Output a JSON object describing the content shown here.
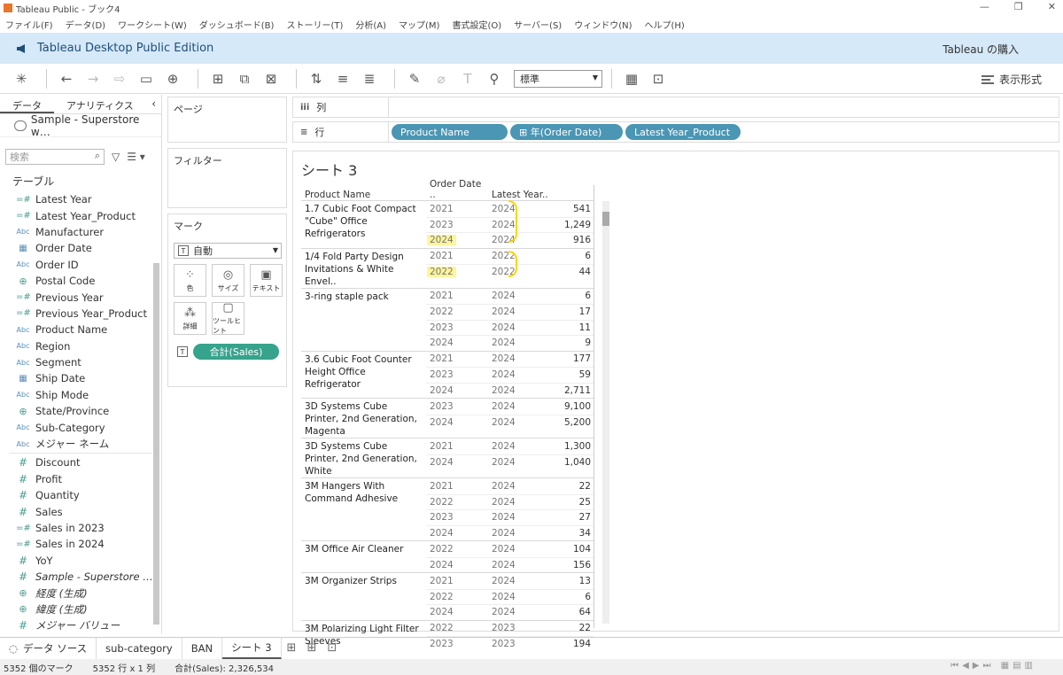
{
  "window": {
    "title": "Tableau Public - ブック4",
    "controls": [
      "—",
      "❐",
      "✕"
    ]
  },
  "menu": [
    "ファイル(F)",
    "データ(D)",
    "ワークシート(W)",
    "ダッシュボード(B)",
    "ストーリー(T)",
    "分析(A)",
    "マップ(M)",
    "書式設定(O)",
    "サーバー(S)",
    "ウィンドウ(N)",
    "ヘルプ(H)"
  ],
  "promo": {
    "label": "Tableau Desktop Public Edition",
    "buy": "Tableau の購入"
  },
  "toolbar": {
    "view_select": "標準",
    "show_me": "表示形式"
  },
  "datapane": {
    "tab_data": "データ",
    "tab_analytics": "アナリティクス",
    "datasource": "Sample - Superstore w…",
    "search_placeholder": "検索",
    "tables_header": "テーブル",
    "dimensions": [
      {
        "icon": "=#",
        "label": "Latest Year"
      },
      {
        "icon": "=#",
        "label": "Latest Year_Product"
      },
      {
        "icon": "Abc",
        "label": "Manufacturer"
      },
      {
        "icon": "date",
        "label": "Order Date"
      },
      {
        "icon": "Abc",
        "label": "Order ID"
      },
      {
        "icon": "geo",
        "label": "Postal Code"
      },
      {
        "icon": "=#",
        "label": "Previous Year"
      },
      {
        "icon": "=#",
        "label": "Previous Year_Product"
      },
      {
        "icon": "Abc",
        "label": "Product Name"
      },
      {
        "icon": "Abc",
        "label": "Region"
      },
      {
        "icon": "Abc",
        "label": "Segment"
      },
      {
        "icon": "date",
        "label": "Ship Date"
      },
      {
        "icon": "Abc",
        "label": "Ship Mode"
      },
      {
        "icon": "geo",
        "label": "State/Province"
      },
      {
        "icon": "Abc",
        "label": "Sub-Category"
      },
      {
        "icon": "Abc",
        "label": "メジャー ネーム"
      }
    ],
    "measures": [
      {
        "icon": "#",
        "label": "Discount"
      },
      {
        "icon": "#",
        "label": "Profit"
      },
      {
        "icon": "#",
        "label": "Quantity"
      },
      {
        "icon": "#",
        "label": "Sales"
      },
      {
        "icon": "=#",
        "label": "Sales in 2023"
      },
      {
        "icon": "=#",
        "label": "Sales in 2024"
      },
      {
        "icon": "#",
        "label": "YoY"
      },
      {
        "icon": "#",
        "label": "Sample - Superstore …",
        "italic": true
      },
      {
        "icon": "geo",
        "label": "経度 (生成)",
        "italic": true
      },
      {
        "icon": "geo",
        "label": "緯度 (生成)",
        "italic": true
      },
      {
        "icon": "#",
        "label": "メジャー バリュー",
        "italic": true
      }
    ]
  },
  "cards": {
    "pages": "ページ",
    "filters": "フィルター",
    "marks": "マーク",
    "mark_type": "自動",
    "mark_buttons": [
      "色",
      "サイズ",
      "テキスト",
      "詳細",
      "ツールヒント"
    ],
    "sales_pill": "合計(Sales)"
  },
  "shelves": {
    "columns_label": "列",
    "rows_label": "行",
    "row_pills": [
      "Product Name",
      "⊞ 年(Order Date)",
      "Latest Year_Product"
    ]
  },
  "sheet": {
    "title": "シート 3",
    "headers": {
      "name": "Product Name",
      "order_date": "Order Date ..",
      "latest_year": "Latest Year.."
    },
    "groups": [
      {
        "name": "1.7 Cubic Foot Compact \"Cube\" Office Refrigerators",
        "rows": [
          {
            "od": "2021",
            "ly": "2024",
            "v": "541"
          },
          {
            "od": "2023",
            "ly": "2024",
            "v": "1,249"
          },
          {
            "od": "2024",
            "ly": "2024",
            "v": "916",
            "hl": true
          }
        ]
      },
      {
        "name": "1/4 Fold Party Design Invitations & White Envel..",
        "rows": [
          {
            "od": "2021",
            "ly": "2022",
            "v": "6"
          },
          {
            "od": "2022",
            "ly": "2022",
            "v": "44",
            "hl": true
          }
        ]
      },
      {
        "name": "3-ring staple pack",
        "rows": [
          {
            "od": "2021",
            "ly": "2024",
            "v": "6"
          },
          {
            "od": "2022",
            "ly": "2024",
            "v": "17"
          },
          {
            "od": "2023",
            "ly": "2024",
            "v": "11"
          },
          {
            "od": "2024",
            "ly": "2024",
            "v": "9"
          }
        ]
      },
      {
        "name": "3.6 Cubic Foot Counter Height Office Refrigerator",
        "rows": [
          {
            "od": "2021",
            "ly": "2024",
            "v": "177"
          },
          {
            "od": "2023",
            "ly": "2024",
            "v": "59"
          },
          {
            "od": "2024",
            "ly": "2024",
            "v": "2,711"
          }
        ]
      },
      {
        "name": "3D Systems Cube Printer, 2nd Generation, Magenta",
        "rows": [
          {
            "od": "2023",
            "ly": "2024",
            "v": "9,100"
          },
          {
            "od": "2024",
            "ly": "2024",
            "v": "5,200"
          }
        ]
      },
      {
        "name": "3D Systems Cube Printer, 2nd Generation, White",
        "rows": [
          {
            "od": "2021",
            "ly": "2024",
            "v": "1,300"
          },
          {
            "od": "2024",
            "ly": "2024",
            "v": "1,040"
          }
        ]
      },
      {
        "name": "3M Hangers With Command Adhesive",
        "rows": [
          {
            "od": "2021",
            "ly": "2024",
            "v": "22"
          },
          {
            "od": "2022",
            "ly": "2024",
            "v": "25"
          },
          {
            "od": "2023",
            "ly": "2024",
            "v": "27"
          },
          {
            "od": "2024",
            "ly": "2024",
            "v": "34"
          }
        ]
      },
      {
        "name": "3M Office Air Cleaner",
        "rows": [
          {
            "od": "2022",
            "ly": "2024",
            "v": "104"
          },
          {
            "od": "2024",
            "ly": "2024",
            "v": "156"
          }
        ]
      },
      {
        "name": "3M Organizer Strips",
        "rows": [
          {
            "od": "2021",
            "ly": "2024",
            "v": "13"
          },
          {
            "od": "2022",
            "ly": "2024",
            "v": "6"
          },
          {
            "od": "2024",
            "ly": "2024",
            "v": "64"
          }
        ]
      },
      {
        "name": "3M Polarizing Light Filter Sleeves",
        "rows": [
          {
            "od": "2022",
            "ly": "2023",
            "v": "22"
          },
          {
            "od": "2023",
            "ly": "2023",
            "v": "194"
          }
        ]
      }
    ]
  },
  "tabs": {
    "datasource": "データ ソース",
    "sheets": [
      "sub-category",
      "BAN",
      "シート 3"
    ]
  },
  "status": {
    "marks": "5352 個のマーク",
    "dims": "5352 行 x 1 列",
    "sum": "合計(Sales): 2,326,534"
  },
  "colors": {
    "pill_blue": "#4a96b4",
    "pill_green": "#36a38c",
    "highlight": "#fff59a",
    "promo_bg": "#d6e9f8"
  }
}
